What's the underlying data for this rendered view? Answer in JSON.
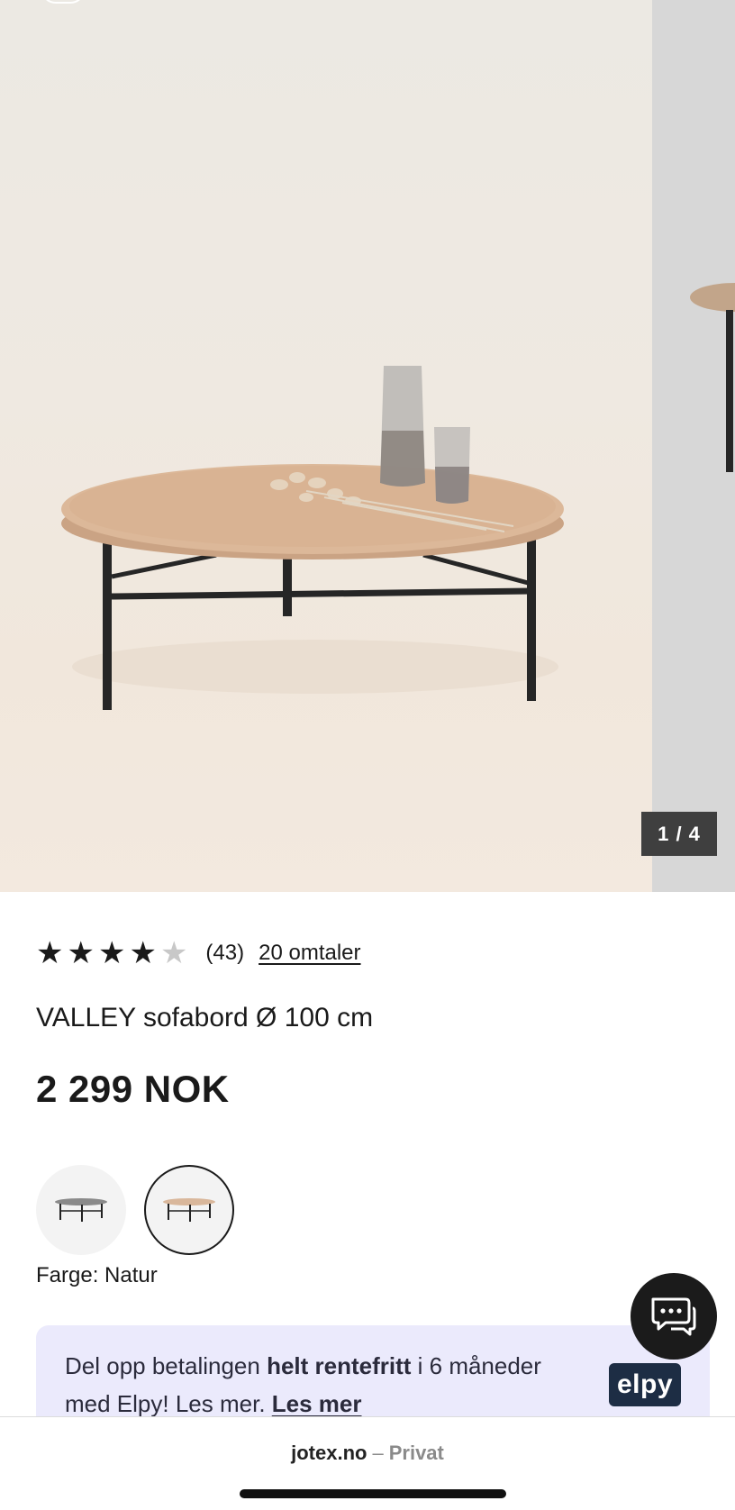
{
  "gallery": {
    "counter": "1 / 4",
    "image_alt": "VALLEY sofabord Ø 100 cm"
  },
  "rating": {
    "value": 4,
    "max": 5,
    "count": "(43)",
    "reviews_link": "20 omtaler"
  },
  "product": {
    "title": "VALLEY sofabord Ø 100 cm",
    "price": "2 299 NOK"
  },
  "colors": {
    "options": [
      {
        "name": "black-variant",
        "top_color": "#8a8a8a"
      },
      {
        "name": "natur-variant",
        "top_color": "#d9b79b",
        "selected": true
      }
    ],
    "label": "Farge: Natur"
  },
  "promo": {
    "text_part1": "Del opp betalingen ",
    "text_bold": "helt rentefritt",
    "text_part2": " i 6 måneder med Elpy! Les mer. ",
    "link": "Les mer",
    "badge": "elpy"
  },
  "chat": {
    "icon": "chat-bubbles-icon"
  },
  "browser": {
    "domain": "jotex.no",
    "separator": "–",
    "mode": "Privat"
  }
}
